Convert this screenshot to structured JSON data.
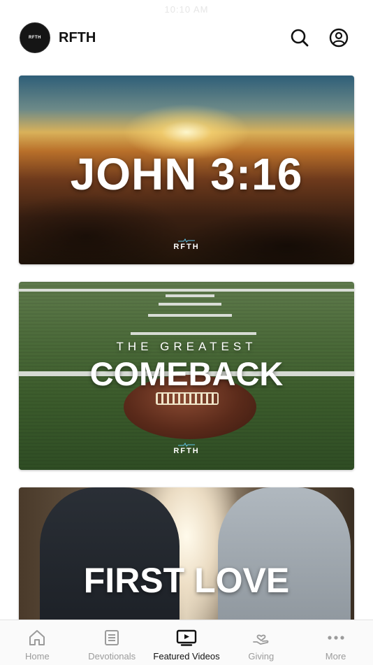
{
  "status_bar": {
    "time": "10:10 AM"
  },
  "header": {
    "logo_text": "RFTH",
    "title": "RFTH",
    "search_icon": "search-icon",
    "profile_icon": "user-circle-icon"
  },
  "cards": [
    {
      "title": "JOHN 3:16",
      "brand": "RFTH",
      "brand_sub": "MINISTRIES"
    },
    {
      "subtitle": "THE GREATEST",
      "title": "COMEBACK",
      "brand": "RFTH",
      "brand_sub": "MINISTRIES"
    },
    {
      "title": "FIRST LOVE"
    }
  ],
  "tabbar": {
    "active_color": "#111111",
    "inactive_color": "#9b9b9b",
    "items": [
      {
        "label": "Home",
        "icon": "home-icon"
      },
      {
        "label": "Devotionals",
        "icon": "book-icon"
      },
      {
        "label": "Featured Videos",
        "icon": "tv-play-icon",
        "active": true
      },
      {
        "label": "Giving",
        "icon": "heart-hand-icon"
      },
      {
        "label": "More",
        "icon": "more-dots-icon"
      }
    ]
  }
}
